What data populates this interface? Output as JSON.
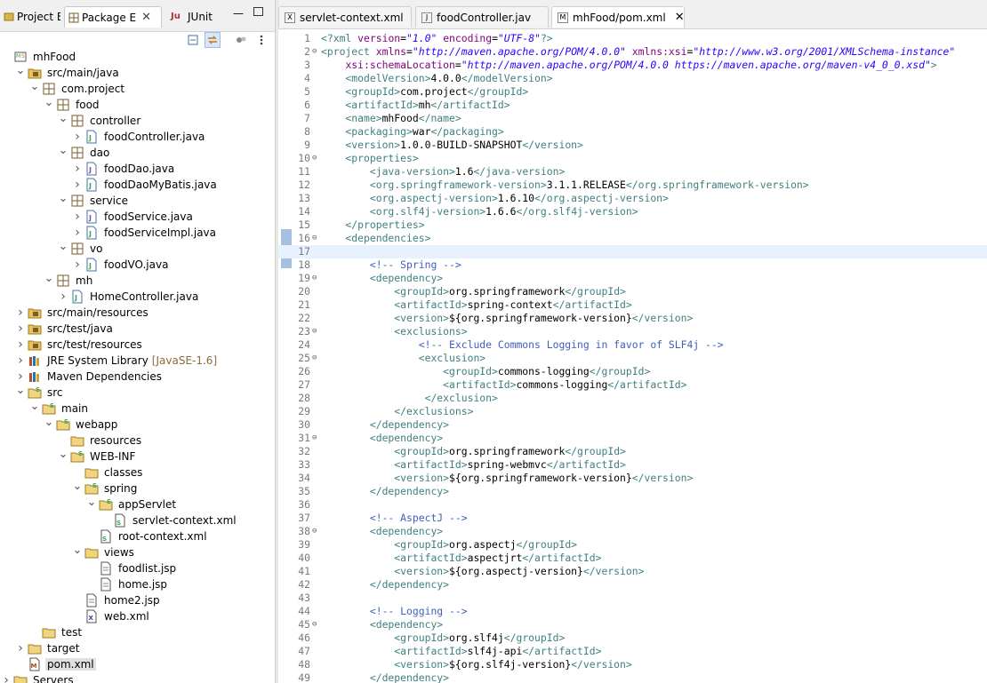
{
  "left_tabs": [
    {
      "label": "Project Ex",
      "icon": "project-explorer-icon"
    },
    {
      "label": "Package E",
      "icon": "package-explorer-icon",
      "active": true
    },
    {
      "label": "JUnit",
      "icon": "junit-icon"
    }
  ],
  "tree": [
    {
      "d": 0,
      "tw": "",
      "icon": "maven-project",
      "label": "mhFood"
    },
    {
      "d": 1,
      "tw": "open",
      "icon": "source-folder",
      "label": "src/main/java"
    },
    {
      "d": 2,
      "tw": "open",
      "icon": "package",
      "label": "com.project"
    },
    {
      "d": 3,
      "tw": "open",
      "icon": "package",
      "label": "food"
    },
    {
      "d": 4,
      "tw": "open",
      "icon": "package",
      "label": "controller"
    },
    {
      "d": 5,
      "tw": "closed",
      "icon": "java-file",
      "label": "foodController.java"
    },
    {
      "d": 4,
      "tw": "open",
      "icon": "package",
      "label": "dao"
    },
    {
      "d": 5,
      "tw": "closed",
      "icon": "java-interface",
      "label": "foodDao.java"
    },
    {
      "d": 5,
      "tw": "closed",
      "icon": "java-file",
      "label": "foodDaoMyBatis.java"
    },
    {
      "d": 4,
      "tw": "open",
      "icon": "package",
      "label": "service"
    },
    {
      "d": 5,
      "tw": "closed",
      "icon": "java-interface",
      "label": "foodService.java"
    },
    {
      "d": 5,
      "tw": "closed",
      "icon": "java-file",
      "label": "foodServiceImpl.java"
    },
    {
      "d": 4,
      "tw": "open",
      "icon": "package",
      "label": "vo"
    },
    {
      "d": 5,
      "tw": "closed",
      "icon": "java-file",
      "label": "foodVO.java"
    },
    {
      "d": 3,
      "tw": "open",
      "icon": "package",
      "label": "mh"
    },
    {
      "d": 4,
      "tw": "closed",
      "icon": "java-file",
      "label": "HomeController.java"
    },
    {
      "d": 1,
      "tw": "closed",
      "icon": "source-folder",
      "label": "src/main/resources"
    },
    {
      "d": 1,
      "tw": "closed",
      "icon": "source-folder",
      "label": "src/test/java"
    },
    {
      "d": 1,
      "tw": "closed",
      "icon": "source-folder",
      "label": "src/test/resources"
    },
    {
      "d": 1,
      "tw": "closed",
      "icon": "library",
      "label": "JRE System Library",
      "extra": "[JavaSE-1.6]"
    },
    {
      "d": 1,
      "tw": "closed",
      "icon": "library",
      "label": "Maven Dependencies"
    },
    {
      "d": 1,
      "tw": "open",
      "icon": "folder-spring",
      "label": "src"
    },
    {
      "d": 2,
      "tw": "open",
      "icon": "folder-spring",
      "label": "main"
    },
    {
      "d": 3,
      "tw": "open",
      "icon": "folder-spring",
      "label": "webapp"
    },
    {
      "d": 4,
      "tw": "",
      "icon": "folder",
      "label": "resources"
    },
    {
      "d": 4,
      "tw": "open",
      "icon": "folder-spring",
      "label": "WEB-INF"
    },
    {
      "d": 5,
      "tw": "",
      "icon": "folder",
      "label": "classes"
    },
    {
      "d": 5,
      "tw": "open",
      "icon": "folder-spring",
      "label": "spring"
    },
    {
      "d": 6,
      "tw": "open",
      "icon": "folder-spring",
      "label": "appServlet"
    },
    {
      "d": 7,
      "tw": "",
      "icon": "spring-xml",
      "label": "servlet-context.xml"
    },
    {
      "d": 6,
      "tw": "",
      "icon": "spring-xml",
      "label": "root-context.xml"
    },
    {
      "d": 5,
      "tw": "open",
      "icon": "folder",
      "label": "views"
    },
    {
      "d": 6,
      "tw": "",
      "icon": "jsp-file",
      "label": "foodlist.jsp"
    },
    {
      "d": 6,
      "tw": "",
      "icon": "jsp-file",
      "label": "home.jsp"
    },
    {
      "d": 5,
      "tw": "",
      "icon": "jsp-file",
      "label": "home2.jsp"
    },
    {
      "d": 5,
      "tw": "",
      "icon": "xml-file",
      "label": "web.xml"
    },
    {
      "d": 2,
      "tw": "",
      "icon": "folder",
      "label": "test"
    },
    {
      "d": 1,
      "tw": "closed",
      "icon": "folder",
      "label": "target"
    },
    {
      "d": 1,
      "tw": "",
      "icon": "maven-pom",
      "label": "pom.xml",
      "selected": true
    },
    {
      "d": 0,
      "tw": "closed",
      "icon": "folder",
      "label": "Servers"
    }
  ],
  "editor_tabs": [
    {
      "label": "servlet-context.xml",
      "icon": "xml-file-icon"
    },
    {
      "label": "foodController.jav",
      "icon": "java-file-icon"
    },
    {
      "label": "mhFood/pom.xml",
      "icon": "maven-pom-icon",
      "active": true
    }
  ],
  "current_line": 17,
  "code": [
    {
      "n": 1,
      "f": "",
      "s": [
        [
          "pi",
          "<?xml "
        ],
        [
          "an",
          "version"
        ],
        [
          "tx",
          "="
        ],
        [
          "av",
          "\"1.0\""
        ],
        [
          "tx",
          " "
        ],
        [
          "an",
          "encoding"
        ],
        [
          "tx",
          "="
        ],
        [
          "av",
          "\"UTF-8\""
        ],
        [
          "pi",
          "?>"
        ]
      ]
    },
    {
      "n": 2,
      "f": "⊖",
      "s": [
        [
          "t",
          "<project "
        ],
        [
          "an",
          "xmlns"
        ],
        [
          "tx",
          "="
        ],
        [
          "av",
          "\"http://maven.apache.org/POM/4.0.0\""
        ],
        [
          "tx",
          " "
        ],
        [
          "an",
          "xmlns:xsi"
        ],
        [
          "tx",
          "="
        ],
        [
          "av",
          "\"http://www.w3.org/2001/XMLSchema-instance\""
        ]
      ]
    },
    {
      "n": 3,
      "f": "",
      "s": [
        [
          "tx",
          "    "
        ],
        [
          "an",
          "xsi:schemaLocation"
        ],
        [
          "tx",
          "="
        ],
        [
          "av",
          "\"http://maven.apache.org/POM/4.0.0 https://maven.apache.org/maven-v4_0_0.xsd\""
        ],
        [
          "t",
          ">"
        ]
      ]
    },
    {
      "n": 4,
      "f": "",
      "s": [
        [
          "t",
          "    <modelVersion>"
        ],
        [
          "tx",
          "4.0.0"
        ],
        [
          "t",
          "</modelVersion>"
        ]
      ]
    },
    {
      "n": 5,
      "f": "",
      "s": [
        [
          "t",
          "    <groupId>"
        ],
        [
          "tx",
          "com.project"
        ],
        [
          "t",
          "</groupId>"
        ]
      ]
    },
    {
      "n": 6,
      "f": "",
      "s": [
        [
          "t",
          "    <artifactId>"
        ],
        [
          "tx",
          "mh"
        ],
        [
          "t",
          "</artifactId>"
        ]
      ]
    },
    {
      "n": 7,
      "f": "",
      "s": [
        [
          "t",
          "    <name>"
        ],
        [
          "tx",
          "mhFood"
        ],
        [
          "t",
          "</name>"
        ]
      ]
    },
    {
      "n": 8,
      "f": "",
      "s": [
        [
          "t",
          "    <packaging>"
        ],
        [
          "tx",
          "war"
        ],
        [
          "t",
          "</packaging>"
        ]
      ]
    },
    {
      "n": 9,
      "f": "",
      "s": [
        [
          "t",
          "    <version>"
        ],
        [
          "tx",
          "1.0.0-BUILD-SNAPSHOT"
        ],
        [
          "t",
          "</version>"
        ]
      ]
    },
    {
      "n": 10,
      "f": "⊖",
      "s": [
        [
          "t",
          "    <properties>"
        ]
      ]
    },
    {
      "n": 11,
      "f": "",
      "s": [
        [
          "t",
          "        <java-version>"
        ],
        [
          "tx",
          "1.6"
        ],
        [
          "t",
          "</java-version>"
        ]
      ]
    },
    {
      "n": 12,
      "f": "",
      "s": [
        [
          "t",
          "        <org.springframework-version>"
        ],
        [
          "tx",
          "3.1.1.RELEASE"
        ],
        [
          "t",
          "</org.springframework-version>"
        ]
      ]
    },
    {
      "n": 13,
      "f": "",
      "s": [
        [
          "t",
          "        <org.aspectj-version>"
        ],
        [
          "tx",
          "1.6.10"
        ],
        [
          "t",
          "</org.aspectj-version>"
        ]
      ]
    },
    {
      "n": 14,
      "f": "",
      "s": [
        [
          "t",
          "        <org.slf4j-version>"
        ],
        [
          "tx",
          "1.6.6"
        ],
        [
          "t",
          "</org.slf4j-version>"
        ]
      ]
    },
    {
      "n": 15,
      "f": "",
      "s": [
        [
          "t",
          "    </properties>"
        ]
      ]
    },
    {
      "n": 16,
      "f": "⊖",
      "s": [
        [
          "t",
          "    <dependencies>"
        ]
      ]
    },
    {
      "n": 17,
      "f": "",
      "s": []
    },
    {
      "n": 18,
      "f": "",
      "s": [
        [
          "cm",
          "        <!-- Spring -->"
        ]
      ]
    },
    {
      "n": 19,
      "f": "⊖",
      "s": [
        [
          "t",
          "        <dependency>"
        ]
      ]
    },
    {
      "n": 20,
      "f": "",
      "s": [
        [
          "t",
          "            <groupId>"
        ],
        [
          "tx",
          "org.springframework"
        ],
        [
          "t",
          "</groupId>"
        ]
      ]
    },
    {
      "n": 21,
      "f": "",
      "s": [
        [
          "t",
          "            <artifactId>"
        ],
        [
          "tx",
          "spring-context"
        ],
        [
          "t",
          "</artifactId>"
        ]
      ]
    },
    {
      "n": 22,
      "f": "",
      "s": [
        [
          "t",
          "            <version>"
        ],
        [
          "tx",
          "${org.springframework-version}"
        ],
        [
          "t",
          "</version>"
        ]
      ]
    },
    {
      "n": 23,
      "f": "⊖",
      "s": [
        [
          "t",
          "            <exclusions>"
        ]
      ]
    },
    {
      "n": 24,
      "f": "",
      "s": [
        [
          "cm",
          "                <!-- Exclude Commons Logging in favor of SLF4j -->"
        ]
      ]
    },
    {
      "n": 25,
      "f": "⊖",
      "s": [
        [
          "t",
          "                <exclusion>"
        ]
      ]
    },
    {
      "n": 26,
      "f": "",
      "s": [
        [
          "t",
          "                    <groupId>"
        ],
        [
          "tx",
          "commons-logging"
        ],
        [
          "t",
          "</groupId>"
        ]
      ]
    },
    {
      "n": 27,
      "f": "",
      "s": [
        [
          "t",
          "                    <artifactId>"
        ],
        [
          "tx",
          "commons-logging"
        ],
        [
          "t",
          "</artifactId>"
        ]
      ]
    },
    {
      "n": 28,
      "f": "",
      "s": [
        [
          "t",
          "                 </exclusion>"
        ]
      ]
    },
    {
      "n": 29,
      "f": "",
      "s": [
        [
          "t",
          "            </exclusions>"
        ]
      ]
    },
    {
      "n": 30,
      "f": "",
      "s": [
        [
          "t",
          "        </dependency>"
        ]
      ]
    },
    {
      "n": 31,
      "f": "⊖",
      "s": [
        [
          "t",
          "        <dependency>"
        ]
      ]
    },
    {
      "n": 32,
      "f": "",
      "s": [
        [
          "t",
          "            <groupId>"
        ],
        [
          "tx",
          "org.springframework"
        ],
        [
          "t",
          "</groupId>"
        ]
      ]
    },
    {
      "n": 33,
      "f": "",
      "s": [
        [
          "t",
          "            <artifactId>"
        ],
        [
          "tx",
          "spring-webmvc"
        ],
        [
          "t",
          "</artifactId>"
        ]
      ]
    },
    {
      "n": 34,
      "f": "",
      "s": [
        [
          "t",
          "            <version>"
        ],
        [
          "tx",
          "${org.springframework-version}"
        ],
        [
          "t",
          "</version>"
        ]
      ]
    },
    {
      "n": 35,
      "f": "",
      "s": [
        [
          "t",
          "        </dependency>"
        ]
      ]
    },
    {
      "n": 36,
      "f": "",
      "s": []
    },
    {
      "n": 37,
      "f": "",
      "s": [
        [
          "cm",
          "        <!-- AspectJ -->"
        ]
      ]
    },
    {
      "n": 38,
      "f": "⊖",
      "s": [
        [
          "t",
          "        <dependency>"
        ]
      ]
    },
    {
      "n": 39,
      "f": "",
      "s": [
        [
          "t",
          "            <groupId>"
        ],
        [
          "tx",
          "org.aspectj"
        ],
        [
          "t",
          "</groupId>"
        ]
      ]
    },
    {
      "n": 40,
      "f": "",
      "s": [
        [
          "t",
          "            <artifactId>"
        ],
        [
          "tx",
          "aspectjrt"
        ],
        [
          "t",
          "</artifactId>"
        ]
      ]
    },
    {
      "n": 41,
      "f": "",
      "s": [
        [
          "t",
          "            <version>"
        ],
        [
          "tx",
          "${org.aspectj-version}"
        ],
        [
          "t",
          "</version>"
        ]
      ]
    },
    {
      "n": 42,
      "f": "",
      "s": [
        [
          "t",
          "        </dependency>"
        ]
      ]
    },
    {
      "n": 43,
      "f": "",
      "s": []
    },
    {
      "n": 44,
      "f": "",
      "s": [
        [
          "cm",
          "        <!-- Logging -->"
        ]
      ]
    },
    {
      "n": 45,
      "f": "⊖",
      "s": [
        [
          "t",
          "        <dependency>"
        ]
      ]
    },
    {
      "n": 46,
      "f": "",
      "s": [
        [
          "t",
          "            <groupId>"
        ],
        [
          "tx",
          "org.slf4j"
        ],
        [
          "t",
          "</groupId>"
        ]
      ]
    },
    {
      "n": 47,
      "f": "",
      "s": [
        [
          "t",
          "            <artifactId>"
        ],
        [
          "tx",
          "slf4j-api"
        ],
        [
          "t",
          "</artifactId>"
        ]
      ]
    },
    {
      "n": 48,
      "f": "",
      "s": [
        [
          "t",
          "            <version>"
        ],
        [
          "tx",
          "${org.slf4j-version}"
        ],
        [
          "t",
          "</version>"
        ]
      ]
    },
    {
      "n": 49,
      "f": "",
      "s": [
        [
          "t",
          "        </dependency>"
        ]
      ]
    }
  ],
  "colors": {
    "tag": "#3f7f7f",
    "attr_name": "#7f007f",
    "attr_value": "#2a00ff",
    "comment": "#3f5fbf",
    "current_line": "#e8f2fe"
  }
}
